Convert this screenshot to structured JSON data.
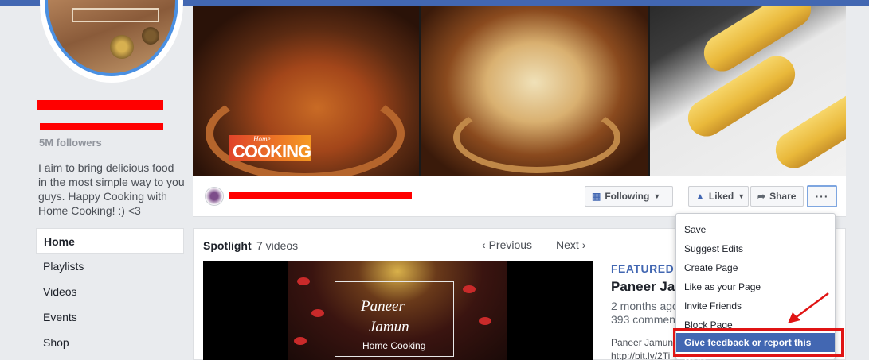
{
  "profile": {
    "followers": "5M followers",
    "about": "I aim to bring delicious food in the most simple way to you guys. Happy Cooking with Home Cooking! :) <3"
  },
  "left_nav": [
    {
      "label": "Home",
      "active": true
    },
    {
      "label": "Playlists"
    },
    {
      "label": "Videos"
    },
    {
      "label": "Events"
    },
    {
      "label": "Shop"
    }
  ],
  "cover": {
    "logo_small": "Home",
    "logo_big": "COOKING"
  },
  "actions": {
    "following": "Following",
    "liked": "Liked",
    "share": "Share",
    "more": "···"
  },
  "spotlight": {
    "title": "Spotlight",
    "count": "7 videos",
    "previous": "Previous",
    "next": "Next",
    "video_title_line1": "Paneer",
    "video_title_line2": "Jamun",
    "video_brand": "Home Cooking",
    "featured_label": "FEATURED",
    "featured_title": "Paneer Jam",
    "featured_age": "2 months ago",
    "featured_comments": "393 commen",
    "featured_desc1": "Paneer Jamun",
    "featured_desc2": "http://bit.ly/2Ti"
  },
  "dropdown": {
    "items": [
      "Save",
      "Suggest Edits",
      "Create Page",
      "Like as your Page",
      "Invite Friends",
      "Block Page"
    ],
    "highlighted": "Give feedback or report this Page"
  },
  "colors": {
    "accent": "#4267b2",
    "highlight_box": "#e01414",
    "redaction": "#ff0000"
  }
}
